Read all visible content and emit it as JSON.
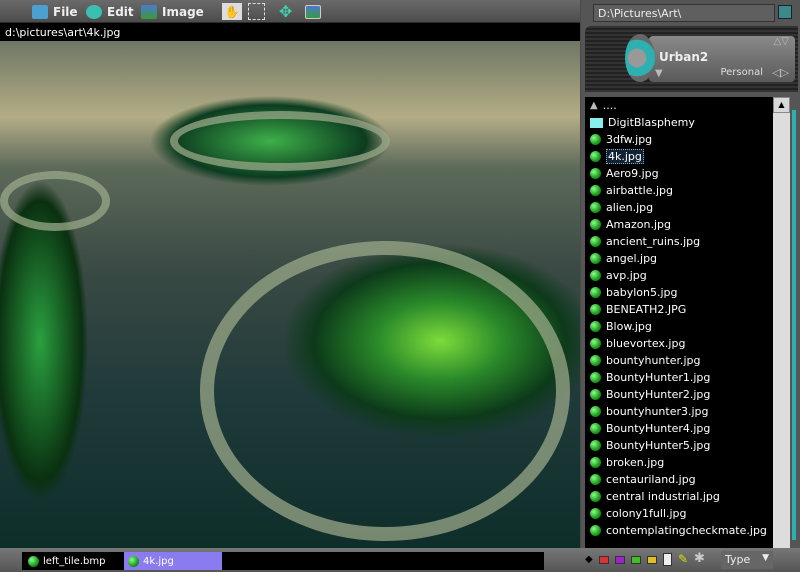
{
  "toolbar": {
    "file": "File",
    "edit": "Edit",
    "image": "Image"
  },
  "path": "d:\\pictures\\art\\4k.jpg",
  "address": "D:\\Pictures\\Art\\",
  "skin": {
    "name": "Urban2",
    "profile": "Personal"
  },
  "files": [
    {
      "name": "....",
      "type": "up"
    },
    {
      "name": "DigitBlasphemy",
      "type": "folder"
    },
    {
      "name": "3dfw.jpg",
      "type": "file"
    },
    {
      "name": "4k.jpg",
      "type": "file",
      "selected": true
    },
    {
      "name": "Aero9.jpg",
      "type": "file"
    },
    {
      "name": "airbattle.jpg",
      "type": "file"
    },
    {
      "name": "alien.jpg",
      "type": "file"
    },
    {
      "name": "Amazon.jpg",
      "type": "file"
    },
    {
      "name": "ancient_ruins.jpg",
      "type": "file"
    },
    {
      "name": "angel.jpg",
      "type": "file"
    },
    {
      "name": "avp.jpg",
      "type": "file"
    },
    {
      "name": "babylon5.jpg",
      "type": "file"
    },
    {
      "name": "BENEATH2.JPG",
      "type": "file"
    },
    {
      "name": "Blow.jpg",
      "type": "file"
    },
    {
      "name": "bluevortex.jpg",
      "type": "file"
    },
    {
      "name": "bountyhunter.jpg",
      "type": "file"
    },
    {
      "name": "BountyHunter1.jpg",
      "type": "file"
    },
    {
      "name": "BountyHunter2.jpg",
      "type": "file"
    },
    {
      "name": "bountyhunter3.jpg",
      "type": "file"
    },
    {
      "name": "BountyHunter4.jpg",
      "type": "file"
    },
    {
      "name": "BountyHunter5.jpg",
      "type": "file"
    },
    {
      "name": "broken.jpg",
      "type": "file"
    },
    {
      "name": "centauriland.jpg",
      "type": "file"
    },
    {
      "name": "central industrial.jpg",
      "type": "file"
    },
    {
      "name": "colony1full.jpg",
      "type": "file"
    },
    {
      "name": "contemplatingcheckmate.jpg",
      "type": "file"
    }
  ],
  "tabs": [
    {
      "label": "left_tile.bmp",
      "active": false
    },
    {
      "label": "4k.jpg",
      "active": true
    }
  ],
  "type_label": "Type",
  "colors": {
    "accent": "#2fb0b0",
    "active_tab": "#8a7cf0",
    "tags": [
      "#e03030",
      "#a020d0",
      "#40c020",
      "#e0c020"
    ]
  }
}
